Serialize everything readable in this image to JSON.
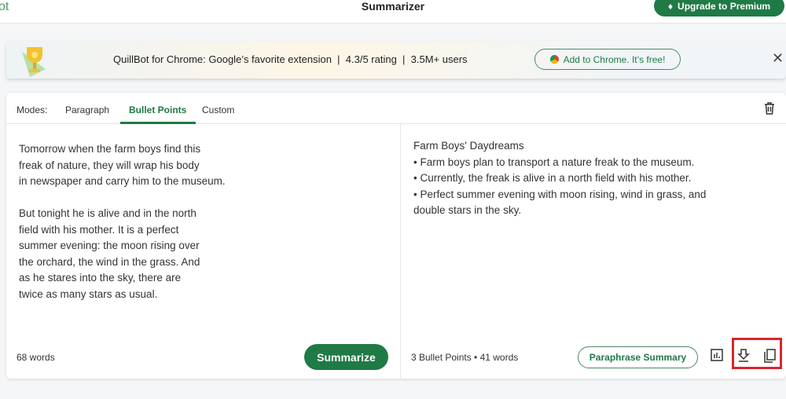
{
  "header": {
    "logo_fragment": "ot",
    "title": "Summarizer",
    "upgrade_label": "Upgrade to Premium"
  },
  "banner": {
    "text": "QuillBot for Chrome: Google’s favorite extension  |  4.3/5 rating  |  3.5M+ users",
    "cta": "Add to Chrome. It’s free!"
  },
  "modes": {
    "label": "Modes:",
    "tabs": [
      "Paragraph",
      "Bullet Points",
      "Custom"
    ],
    "active": "Bullet Points"
  },
  "input": {
    "text": "Tomorrow when the farm boys find this\nfreak of nature, they will wrap his body\nin newspaper and carry him to the museum.\n\nBut tonight he is alive and in the north\nfield with his mother. It is a perfect\nsummer evening: the moon rising over\nthe orchard, the wind in the grass. And\nas he stares into the sky, there are\ntwice as many stars as usual.",
    "word_count": "68 words",
    "summarize_label": "Summarize"
  },
  "output": {
    "title": "Farm Boys' Daydreams",
    "bullets": [
      "• Farm boys plan to transport a nature freak to the museum.",
      "• Currently, the freak is alive in a north field with his mother.",
      "• Perfect summer evening with moon rising, wind in grass, and double stars in the sky."
    ],
    "stats": "3 Bullet Points • 41 words",
    "paraphrase_label": "Paraphrase Summary"
  },
  "colors": {
    "brand": "#1f7a45",
    "highlight": "#d9262c"
  }
}
